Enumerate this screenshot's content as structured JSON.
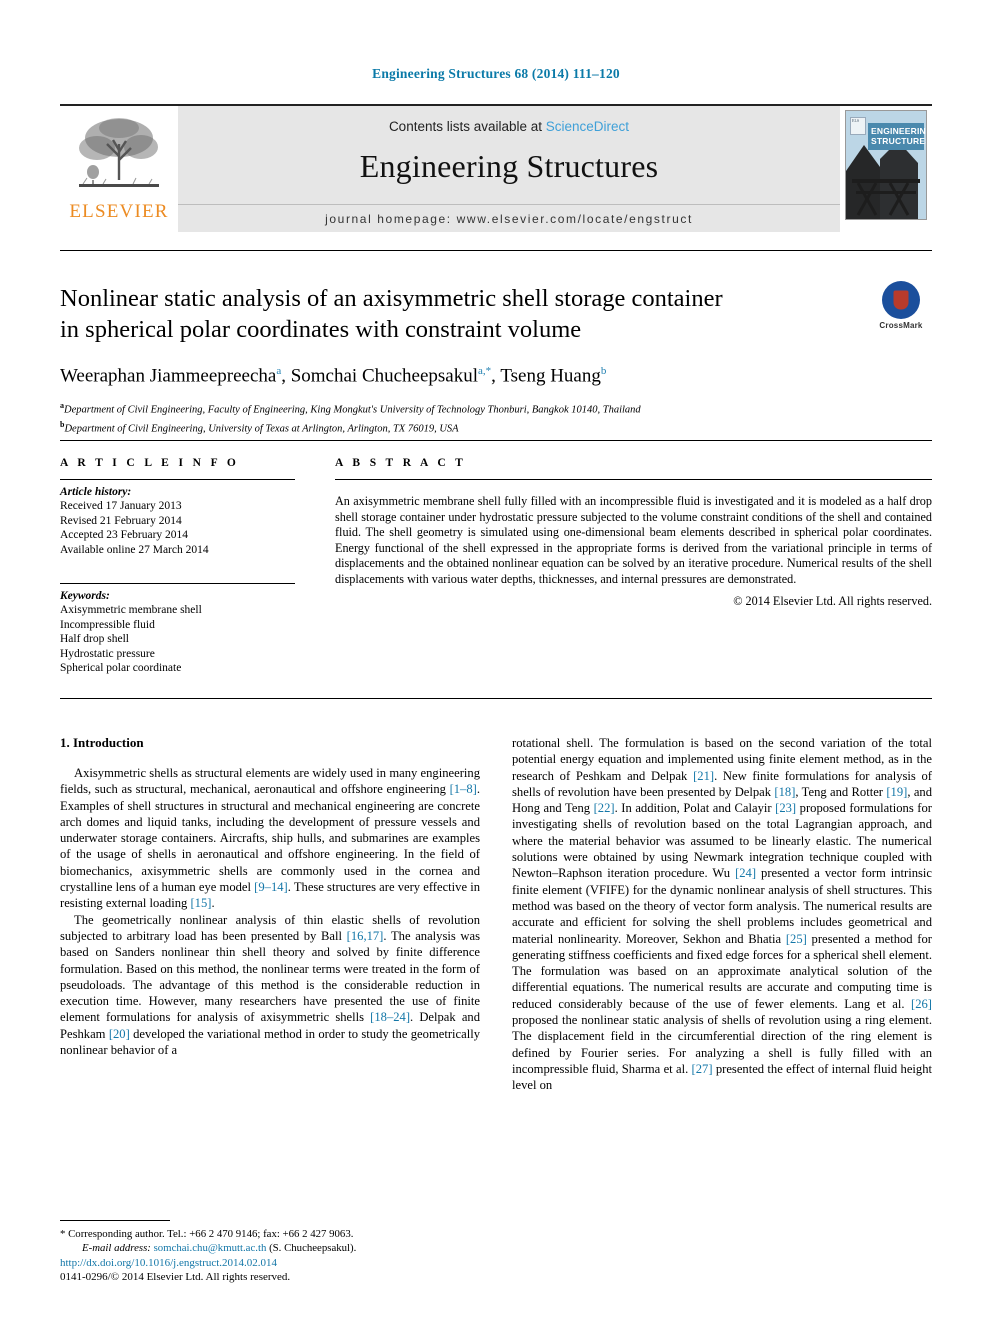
{
  "running_head": "Engineering Structures 68 (2014) 111–120",
  "masthead": {
    "contents_prefix": "Contents lists available at ",
    "sciencedirect": "ScienceDirect",
    "journal_name": "Engineering Structures",
    "homepage": "journal homepage: www.elsevier.com/locate/engstruct",
    "publisher_logo_text": "ELSEVIER",
    "cover_title_line1": "ENGINEERING",
    "cover_title_line2": "STRUCTURES"
  },
  "title": {
    "line1": "Nonlinear static analysis of an axisymmetric shell storage container",
    "line2": "in spherical polar coordinates with constraint volume"
  },
  "crossmark": {
    "label": "CrossMark"
  },
  "authors": {
    "a1_name": "Weeraphan Jiammeepreecha",
    "a1_sup": "a",
    "a2_name": "Somchai Chucheepsakul",
    "a2_sup": "a,*",
    "a3_name": "Tseng Huang",
    "a3_sup": "b",
    "sep": ", "
  },
  "affiliations": [
    {
      "sup": "a",
      "text": "Department of Civil Engineering, Faculty of Engineering, King Mongkut's University of Technology Thonburi, Bangkok 10140, Thailand"
    },
    {
      "sup": "b",
      "text": "Department of Civil Engineering, University of Texas at Arlington, Arlington, TX 76019, USA"
    }
  ],
  "article_info": {
    "heading": "A R T I C L E   I N F O",
    "history_label": "Article history:",
    "history": [
      "Received 17 January 2013",
      "Revised 21 February 2014",
      "Accepted 23 February 2014",
      "Available online 27 March 2014"
    ],
    "keywords_label": "Keywords:",
    "keywords": [
      "Axisymmetric membrane shell",
      "Incompressible fluid",
      "Half drop shell",
      "Hydrostatic pressure",
      "Spherical polar coordinate"
    ]
  },
  "abstract": {
    "heading": "A B S T R A C T",
    "text": "An axisymmetric membrane shell fully filled with an incompressible fluid is investigated and it is modeled as a half drop shell storage container under hydrostatic pressure subjected to the volume constraint conditions of the shell and contained fluid. The shell geometry is simulated using one-dimensional beam elements described in spherical polar coordinates. Energy functional of the shell expressed in the appropriate forms is derived from the variational principle in terms of displacements and the obtained nonlinear equation can be solved by an iterative procedure. Numerical results of the shell displacements with various water depths, thicknesses, and internal pressures are demonstrated.",
    "copyright": "© 2014 Elsevier Ltd. All rights reserved."
  },
  "introduction": {
    "heading": "1. Introduction",
    "left_paragraphs": [
      "Axisymmetric shells as structural elements are widely used in many engineering fields, such as structural, mechanical, aeronautical and offshore engineering [1–8]. Examples of shell structures in structural and mechanical engineering are concrete arch domes and liquid tanks, including the development of pressure vessels and underwater storage containers. Aircrafts, ship hulls, and submarines are examples of the usage of shells in aeronautical and offshore engineering. In the field of biomechanics, axisymmetric shells are commonly used in the cornea and crystalline lens of a human eye model [9–14]. These structures are very effective in resisting external loading [15].",
      "The geometrically nonlinear analysis of thin elastic shells of revolution subjected to arbitrary load has been presented by Ball [16,17]. The analysis was based on Sanders nonlinear thin shell theory and solved by finite difference formulation. Based on this method, the nonlinear terms were treated in the form of pseudoloads. The advantage of this method is the considerable reduction in execution time. However, many researchers have presented the use of finite element formulations for analysis of axisymmetric shells [18–24]. Delpak and Peshkam [20] developed the variational method in order to study the geometrically nonlinear behavior of a"
    ],
    "right_paragraphs": [
      "rotational shell. The formulation is based on the second variation of the total potential energy equation and implemented using finite element method, as in the research of Peshkam and Delpak [21]. New finite formulations for analysis of shells of revolution have been presented by Delpak [18], Teng and Rotter [19], and Hong and Teng [22]. In addition, Polat and Calayir [23] proposed formulations for investigating shells of revolution based on the total Lagrangian approach, and where the material behavior was assumed to be linearly elastic. The numerical solutions were obtained by using Newmark integration technique coupled with Newton–Raphson iteration procedure. Wu [24] presented a vector form intrinsic finite element (VFIFE) for the dynamic nonlinear analysis of shell structures. This method was based on the theory of vector form analysis. The numerical results are accurate and efficient for solving the shell problems includes geometrical and material nonlinearity. Moreover, Sekhon and Bhatia [25] presented a method for generating stiffness coefficients and fixed edge forces for a spherical shell element. The formulation was based on an approximate analytical solution of the differential equations. The numerical results are accurate and computing time is reduced considerably because of the use of fewer elements. Lang et al. [26] proposed the nonlinear static analysis of shells of revolution using a ring element. The displacement field in the circumferential direction of the ring element is defined by Fourier series. For analyzing a shell is fully filled with an incompressible fluid, Sharma et al. [27] presented the effect of internal fluid height level on"
    ]
  },
  "footnote": {
    "marker": "*",
    "corresponding": "Corresponding author. Tel.: +66 2 470 9146; fax: +66 2 427 9063.",
    "email_label": "E-mail address:",
    "email": "somchai.chu@kmutt.ac.th",
    "email_owner": "(S. Chucheepsakul)."
  },
  "doi_block": {
    "doi": "http://dx.doi.org/10.1016/j.engstruct.2014.02.014",
    "issn": "0141-0296/© 2014 Elsevier Ltd. All rights reserved."
  },
  "colors": {
    "link": "#1477a8",
    "running_head": "#0b7aa8",
    "sciencedirect": "#3fa0d8",
    "elsevier_orange": "#ec8b22",
    "cover_blue": "#4a89ad",
    "crossmark_blue": "#1b4f9c",
    "crossmark_red": "#b93b2b"
  }
}
